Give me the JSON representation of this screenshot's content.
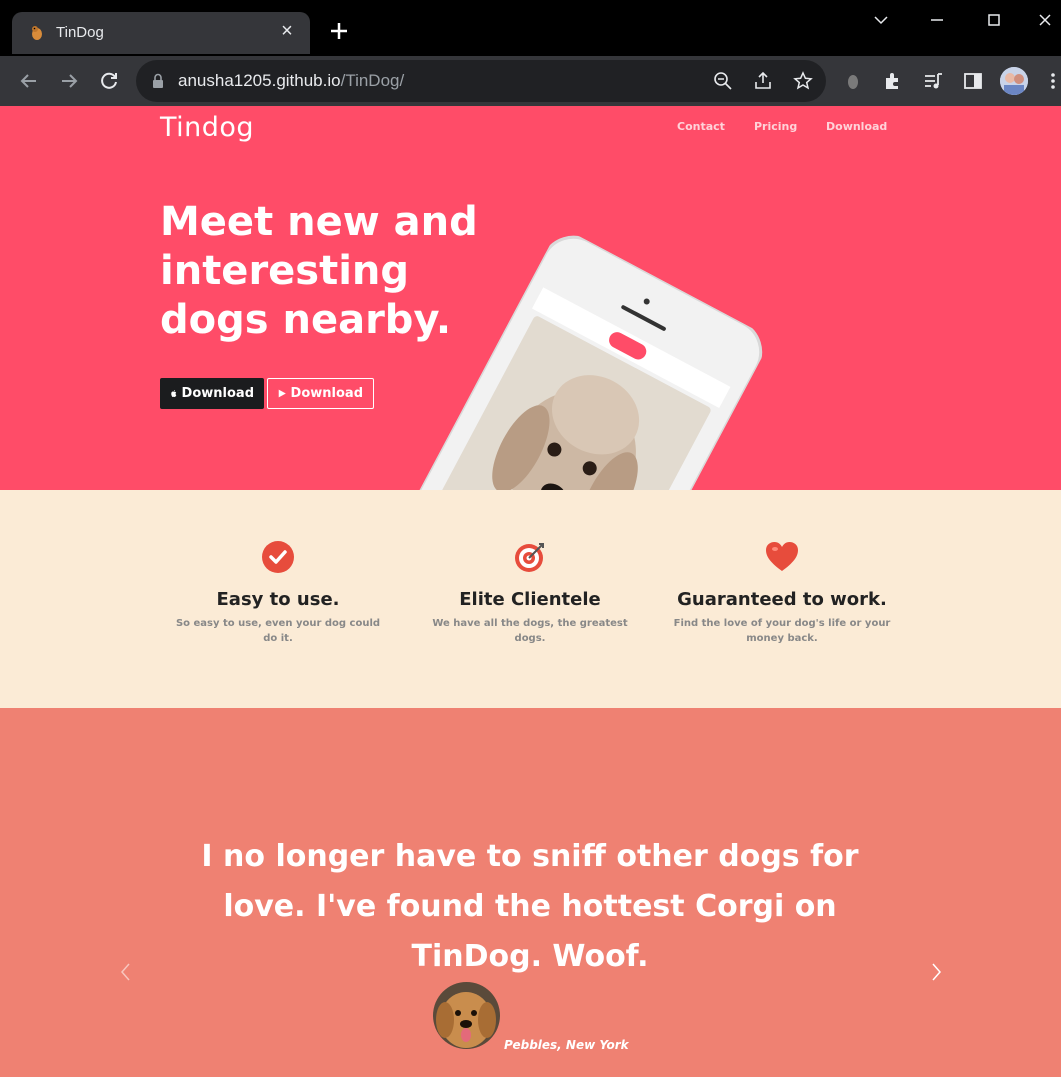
{
  "browser": {
    "tab_title": "TinDog",
    "tab_close": "×",
    "url_host": "anusha1205.github.io",
    "url_path": "/TinDog/"
  },
  "nav": {
    "brand": "Tindog",
    "links": [
      "Contact",
      "Pricing",
      "Download"
    ]
  },
  "hero": {
    "title": "Meet new and interesting dogs nearby.",
    "apple_button": "Download",
    "play_button": "Download"
  },
  "features": [
    {
      "title": "Easy to use.",
      "text": "So easy to use, even your dog could do it.",
      "icon": "check-circle-icon",
      "color": "#e74c3c"
    },
    {
      "title": "Elite Clientele",
      "text": "We have all the dogs, the greatest dogs.",
      "icon": "bullseye-icon",
      "color": "#e74c3c"
    },
    {
      "title": "Guaranteed to work.",
      "text": "Find the love of your dog's life or your money back.",
      "icon": "heart-icon",
      "color": "#e74c3c"
    }
  ],
  "testimonial": {
    "quote": "I no longer have to sniff other dogs for love. I've found the hottest Corgi on TinDog. Woof.",
    "author": "Pebbles, New York"
  },
  "colors": {
    "hero_bg": "#ff4c68",
    "features_bg": "#fbebd6",
    "testimonial_bg": "#ef8172"
  }
}
